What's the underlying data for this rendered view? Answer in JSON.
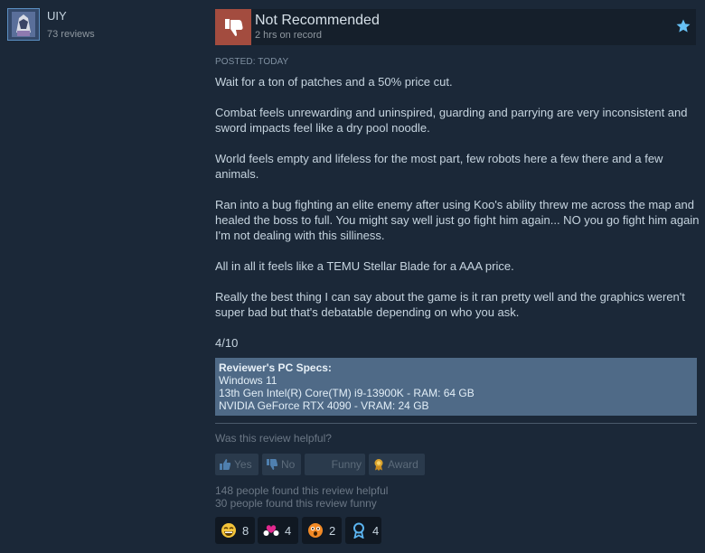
{
  "author": {
    "name": "UIY",
    "review_count": "73 reviews"
  },
  "review": {
    "verdict": "Not Recommended",
    "hours": "2 hrs on record",
    "posted": "POSTED: TODAY",
    "paragraphs": [
      "Wait for a ton of patches and a 50% price cut.",
      "Combat feels unrewarding and uninspired, guarding and parrying are very inconsistent and sword impacts feel like a dry pool noodle.",
      "World feels empty and lifeless for the most part, few robots here a few there and a few animals.",
      "Ran into a bug fighting an elite enemy after using Koo's ability threw me across the map and healed the boss to full. You might say well just go fight him again... NO you go fight him again I'm not dealing with this silliness.",
      "All in all it feels like a TEMU Stellar Blade for a AAA price.",
      "Really the best thing I can say about the game is it ran pretty well and the graphics weren't super bad but that's debatable depending on who you ask.",
      "4/10"
    ]
  },
  "specs": {
    "title": "Reviewer's PC Specs:",
    "os": "Windows 11",
    "cpu": "13th Gen Intel(R) Core(TM) i9-13900K - RAM: 64 GB",
    "gpu": "NVIDIA GeForce RTX 4090 - VRAM: 24 GB"
  },
  "feedback": {
    "question": "Was this review helpful?",
    "yes_label": "Yes",
    "no_label": "No",
    "funny_label": "Funny",
    "award_label": "Award",
    "helpful_stat": "148 people found this review helpful",
    "funny_stat": "30 people found this review funny"
  },
  "awards": [
    {
      "icon": "laughing-emoji-icon",
      "count": "8"
    },
    {
      "icon": "heart-hands-icon",
      "count": "4"
    },
    {
      "icon": "wow-emoji-icon",
      "count": "2"
    },
    {
      "icon": "ribbon-medal-icon",
      "count": "4"
    }
  ],
  "colors": {
    "background": "#1b2838",
    "thumb_down": "#a34c3f",
    "specs_box": "#4f6a87",
    "accent": "#66c0f4"
  }
}
